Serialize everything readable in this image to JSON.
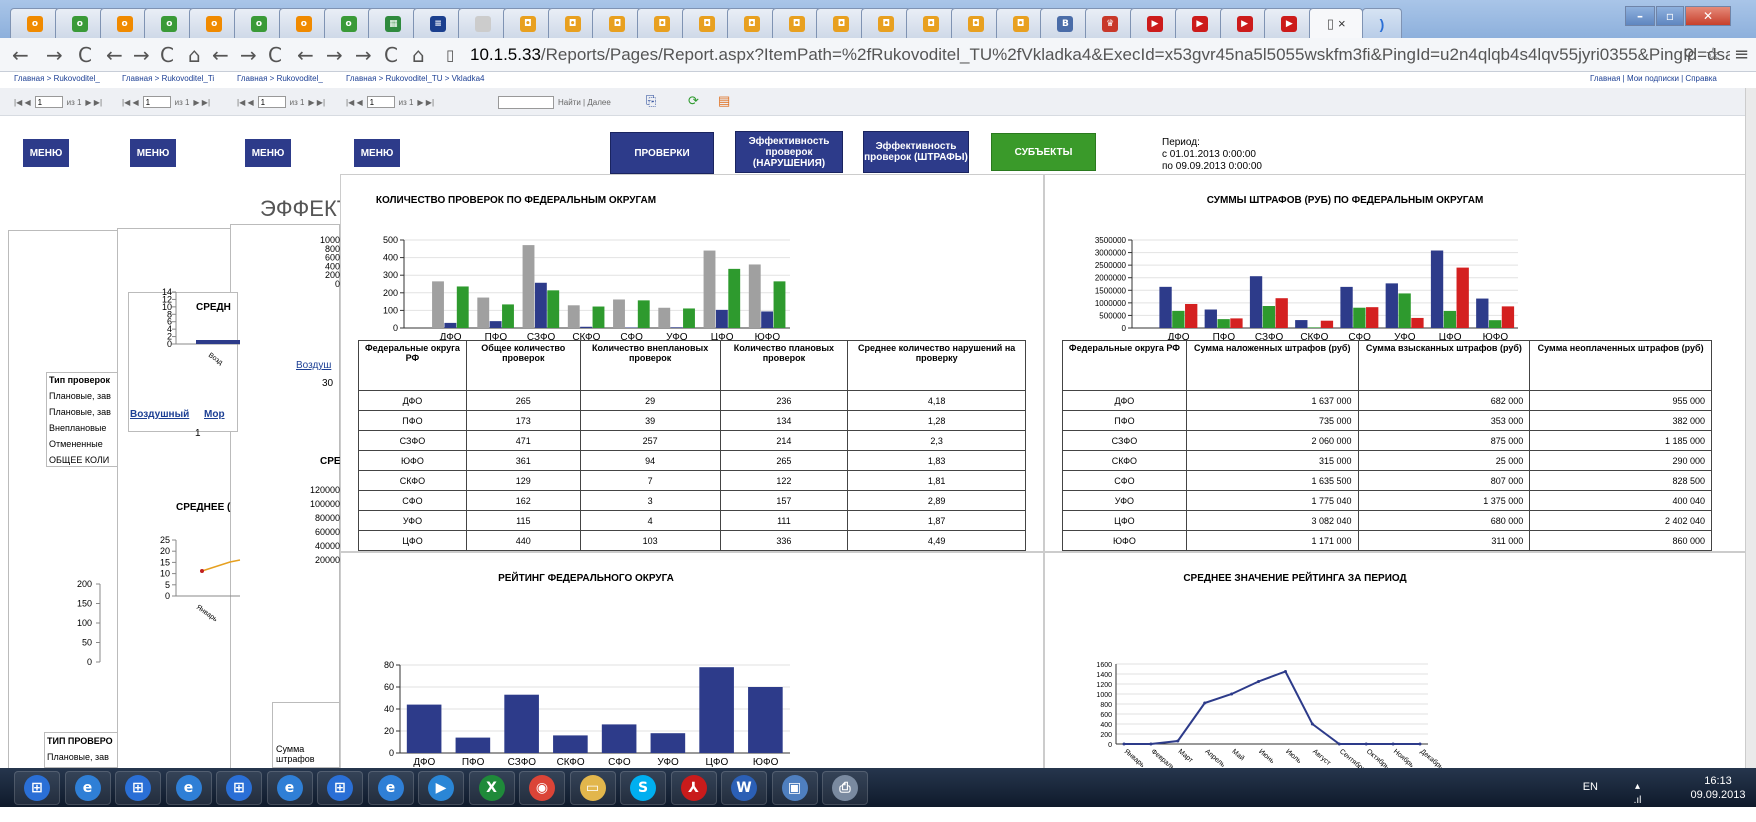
{
  "browser": {
    "tabs": [
      {
        "icon": "o",
        "color": "#f08a00"
      },
      {
        "icon": "o",
        "color": "#3a9a38"
      },
      {
        "icon": "o",
        "color": "#f08a00"
      },
      {
        "icon": "o",
        "color": "#3a9a38"
      },
      {
        "icon": "o",
        "color": "#f08a00"
      },
      {
        "icon": "o",
        "color": "#3a9a38"
      },
      {
        "icon": "o",
        "color": "#f08a00"
      },
      {
        "icon": "o",
        "color": "#3a9a38"
      },
      {
        "icon": "▦",
        "color": "#2f8a3e"
      },
      {
        "icon": "≡",
        "color": "#1b3f8e"
      },
      {
        "icon": "",
        "color": "#ccc"
      },
      {
        "icon": "◘",
        "color": "#e8a020"
      },
      {
        "icon": "◘",
        "color": "#e8a020"
      },
      {
        "icon": "◘",
        "color": "#e8a020"
      },
      {
        "icon": "◘",
        "color": "#e8a020"
      },
      {
        "icon": "◘",
        "color": "#e8a020"
      },
      {
        "icon": "◘",
        "color": "#e8a020"
      },
      {
        "icon": "◘",
        "color": "#e8a020"
      },
      {
        "icon": "◘",
        "color": "#e8a020"
      },
      {
        "icon": "◘",
        "color": "#e8a020"
      },
      {
        "icon": "◘",
        "color": "#e8a020"
      },
      {
        "icon": "◘",
        "color": "#e8a020"
      },
      {
        "icon": "◘",
        "color": "#e8a020"
      },
      {
        "icon": "B",
        "color": "#4a6ca8"
      },
      {
        "icon": "♛",
        "color": "#c8382a"
      },
      {
        "icon": "▶",
        "color": "#cc1b1b"
      },
      {
        "icon": "▶",
        "color": "#cc1b1b"
      },
      {
        "icon": "▶",
        "color": "#cc1b1b"
      },
      {
        "icon": "▶",
        "color": "#cc1b1b"
      }
    ],
    "active_tab_close": "×",
    "url_host": "10.1.5.33",
    "url_rest": "/Reports/Pages/Report.aspx?ItemPath=%2fRukovoditel_TU%2fVkladka4&ExecId=x53gvr45na5l5055wskfm3fi&PingId=u2n4qlqb4s4lqv55jyri0355&PingId=dsaj5255"
  },
  "breadcrumbs": {
    "items": [
      "Главная > Rukovoditel_",
      "Главная > Rukovoditel_Ti",
      "Главная > Rukovoditel_",
      "Главная > Rukovoditel_TU > Vkladka4"
    ],
    "right": "Главная | Мои подписки | Справка"
  },
  "report_toolbar": {
    "page": "1",
    "of_label": "из 1",
    "find_label": "Найти | Далее"
  },
  "header": {
    "menu_label": "МЕНЮ",
    "btn_checks": "ПРОВЕРКИ",
    "btn_eff_violations": "Эффективность проверок (НАРУШЕНИЯ)",
    "btn_eff_fines": "Эффективность проверок (ШТРАФЫ)",
    "btn_subjects": "СУБЪЕКТЫ",
    "period_label": "Период:",
    "period_from": "с  01.01.2013 0:00:00",
    "period_to": "по 09.09.2013 0:00:00",
    "bg_title": "ЭФФЕКТ"
  },
  "bg_fragments": {
    "sred": "СРЕДН",
    "cpe": "СРЕ",
    "sredn2": "СРЕДНЕЕ (",
    "vozd": "Воздуш",
    "vozdushny": "Воздушный",
    "mor": "Мор",
    "val1": "1",
    "val30": "30",
    "tip": "Тип проверок",
    "rows": [
      "Плановые, зав",
      "Плановые, зав",
      "Внеплановые",
      "Отмененные",
      "ОБЩЕЕ КОЛИ"
    ],
    "tip2": "ТИП ПРОВЕРО",
    "row2": "Плановые, зав",
    "summa": "Сумма штрафов",
    "y1": [
      "200",
      "150",
      "100",
      "50",
      "0"
    ],
    "y2": [
      "25",
      "20",
      "15",
      "10",
      "5",
      "0"
    ],
    "y3": [
      "120000",
      "100000",
      "80000",
      "60000",
      "40000",
      "20000"
    ],
    "y4": [
      "1000",
      "800",
      "600",
      "400",
      "200",
      "0"
    ],
    "y5": [
      "14",
      "12",
      "10",
      "8",
      "6",
      "4",
      "2",
      "0"
    ],
    "ylab": "Январь",
    "vozd_tick": "Возд"
  },
  "charts": {
    "checks": {
      "title": "КОЛИЧЕСТВО ПРОВЕРОК ПО ФЕДЕРАЛЬНЫМ ОКРУГАМ",
      "ticks": [
        "500",
        "400",
        "300",
        "200",
        "100",
        "0"
      ],
      "legend": [
        "Общее количество проверок",
        "Количество внеплановых проверок",
        "Количество плановых проверок"
      ]
    },
    "fines": {
      "title": "СУММЫ ШТРАФОВ (РУБ) ПО ФЕДЕРАЛЬНЫМ ОКРУГАМ",
      "ticks": [
        "3500000",
        "3000000",
        "2500000",
        "2000000",
        "1500000",
        "1000000",
        "500000",
        "0"
      ],
      "legend": [
        "Сумма наложенных штрафов",
        "Сумма взысканных штрафов",
        "Сумма неоплаченных штрафов"
      ]
    },
    "rating": {
      "title": "РЕЙТИНГ ФЕДЕРАЛЬНОГО ОКРУГА",
      "ticks": [
        "80",
        "60",
        "40",
        "20",
        "0"
      ]
    },
    "avg_rating": {
      "title": "СРЕДНЕЕ ЗНАЧЕНИЕ РЕЙТИНГА ЗА ПЕРИОД",
      "ticks": [
        "1600",
        "1400",
        "1200",
        "1000",
        "800",
        "600",
        "400",
        "200",
        "0"
      ]
    }
  },
  "chart_data": [
    {
      "type": "bar",
      "title": "КОЛИЧЕСТВО ПРОВЕРОК ПО ФЕДЕРАЛЬНЫМ ОКРУГАМ",
      "categories": [
        "ДФО",
        "ПФО",
        "СЗФО",
        "СКФО",
        "СФО",
        "УФО",
        "ЦФО",
        "ЮФО"
      ],
      "ylim": [
        0,
        500
      ],
      "colors": [
        "#a0a0a0",
        "#2d3b8a",
        "#2e9a2e"
      ],
      "series": [
        {
          "name": "Общее количество проверок",
          "values": [
            265,
            173,
            471,
            129,
            162,
            115,
            440,
            361
          ]
        },
        {
          "name": "Количество внеплановых проверок",
          "values": [
            29,
            39,
            257,
            7,
            3,
            4,
            103,
            94
          ]
        },
        {
          "name": "Количество плановых проверок",
          "values": [
            236,
            134,
            214,
            122,
            157,
            111,
            336,
            265
          ]
        }
      ]
    },
    {
      "type": "bar",
      "title": "СУММЫ ШТРАФОВ (РУБ) ПО ФЕДЕРАЛЬНЫМ ОКРУГАМ",
      "categories": [
        "ДФО",
        "ПФО",
        "СЗФО",
        "СКФО",
        "СФО",
        "УФО",
        "ЦФО",
        "ЮФО"
      ],
      "ylim": [
        0,
        3500000
      ],
      "colors": [
        "#2d3b8a",
        "#2e9a2e",
        "#d42020"
      ],
      "series": [
        {
          "name": "Сумма наложенных штрафов",
          "values": [
            1637000,
            735000,
            2060000,
            315000,
            1635500,
            1775040,
            3082040,
            1171000
          ]
        },
        {
          "name": "Сумма взысканных штрафов",
          "values": [
            682000,
            353000,
            875000,
            25000,
            807000,
            1375000,
            680000,
            311000
          ]
        },
        {
          "name": "Сумма неоплаченных штрафов",
          "values": [
            955000,
            382000,
            1185000,
            290000,
            828500,
            400040,
            2402040,
            860000
          ]
        }
      ]
    },
    {
      "type": "bar",
      "title": "РЕЙТИНГ ФЕДЕРАЛЬНОГО ОКРУГА",
      "categories": [
        "ДФО",
        "ПФО",
        "СЗФО",
        "СКФО",
        "СФО",
        "УФО",
        "ЦФО",
        "ЮФО"
      ],
      "ylim": [
        0,
        80
      ],
      "colors": [
        "#2d3b8a"
      ],
      "values": [
        44,
        14,
        53,
        16,
        26,
        18,
        78,
        60
      ]
    },
    {
      "type": "line",
      "title": "СРЕДНЕЕ ЗНАЧЕНИЕ РЕЙТИНГА ЗА ПЕРИОД",
      "x": [
        "Январь",
        "Февраль",
        "Март",
        "Апрель",
        "Май",
        "Июнь",
        "Июль",
        "Август",
        "Сентябрь",
        "Октябрь",
        "Ноябрь",
        "Декабрь"
      ],
      "ylim": [
        0,
        1600
      ],
      "colors": [
        "#2d3b8a"
      ],
      "values": [
        0,
        0,
        60,
        820,
        1000,
        1250,
        1450,
        400,
        0,
        0,
        0,
        0
      ]
    }
  ],
  "checks_table": {
    "headers": [
      "Федеральные округа РФ",
      "Общее количество проверок",
      "Количество внеплановых проверок",
      "Количество плановых проверок",
      "Среднее количество нарушений на проверку"
    ],
    "rows": [
      [
        "ДФО",
        "265",
        "29",
        "236",
        "4,18"
      ],
      [
        "ПФО",
        "173",
        "39",
        "134",
        "1,28"
      ],
      [
        "СЗФО",
        "471",
        "257",
        "214",
        "2,3"
      ],
      [
        "ЮФО",
        "361",
        "94",
        "265",
        "1,83"
      ],
      [
        "СКФО",
        "129",
        "7",
        "122",
        "1,81"
      ],
      [
        "СФО",
        "162",
        "3",
        "157",
        "2,89"
      ],
      [
        "УФО",
        "115",
        "4",
        "111",
        "1,87"
      ],
      [
        "ЦФО",
        "440",
        "103",
        "336",
        "4,49"
      ]
    ]
  },
  "fines_table": {
    "headers": [
      "Федеральные округа РФ",
      "Сумма наложенных штрафов (руб)",
      "Сумма взысканных штрафов (руб)",
      "Сумма неоплаченных штрафов (руб)"
    ],
    "rows": [
      [
        "ДФО",
        "1 637 000",
        "682 000",
        "955 000"
      ],
      [
        "ПФО",
        "735 000",
        "353 000",
        "382 000"
      ],
      [
        "СЗФО",
        "2 060 000",
        "875 000",
        "1 185 000"
      ],
      [
        "СКФО",
        "315 000",
        "25 000",
        "290 000"
      ],
      [
        "СФО",
        "1 635 500",
        "807 000",
        "828 500"
      ],
      [
        "УФО",
        "1 775 040",
        "1 375 000",
        "400 040"
      ],
      [
        "ЦФО",
        "3 082 040",
        "680 000",
        "2 402 040"
      ],
      [
        "ЮФО",
        "1 171 000",
        "311 000",
        "860 000"
      ]
    ]
  },
  "taskbar": {
    "apps": [
      {
        "name": "start",
        "glyph": "⊞",
        "color": "#2a6fd6"
      },
      {
        "name": "ie",
        "glyph": "e",
        "color": "#2f7fd6"
      },
      {
        "name": "start",
        "glyph": "⊞",
        "color": "#2a6fd6"
      },
      {
        "name": "ie",
        "glyph": "e",
        "color": "#2f7fd6"
      },
      {
        "name": "start",
        "glyph": "⊞",
        "color": "#2a6fd6"
      },
      {
        "name": "ie",
        "glyph": "e",
        "color": "#2f7fd6"
      },
      {
        "name": "start",
        "glyph": "⊞",
        "color": "#2a6fd6"
      },
      {
        "name": "ie",
        "glyph": "e",
        "color": "#2f7fd6"
      },
      {
        "name": "media",
        "glyph": "▶",
        "color": "#2a86d6"
      },
      {
        "name": "excel",
        "glyph": "X",
        "color": "#1f8a3a"
      },
      {
        "name": "chrome",
        "glyph": "◉",
        "color": "#db4437"
      },
      {
        "name": "explorer",
        "glyph": "▭",
        "color": "#e2b64c"
      },
      {
        "name": "skype",
        "glyph": "S",
        "color": "#00aff0"
      },
      {
        "name": "acrobat",
        "glyph": "⅄",
        "color": "#c91b1b"
      },
      {
        "name": "word",
        "glyph": "W",
        "color": "#2b5fb5"
      },
      {
        "name": "remote",
        "glyph": "▣",
        "color": "#4f7fbf"
      },
      {
        "name": "printer",
        "glyph": "⎙",
        "color": "#7a8aa0"
      }
    ],
    "lang": "EN",
    "time": "16:13",
    "date": "09.09.2013"
  }
}
